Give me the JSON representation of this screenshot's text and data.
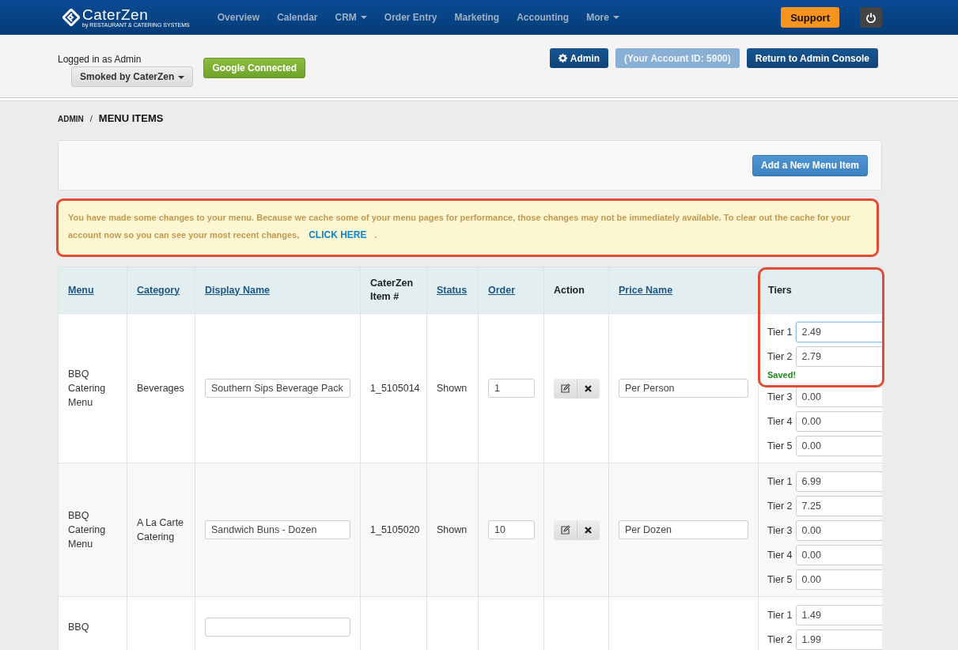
{
  "navbar": {
    "logo": {
      "name": "CaterZen",
      "tagline": "by RESTAURANT & CATERING SYSTEMS"
    },
    "items": [
      {
        "label": "Overview",
        "dropdown": false
      },
      {
        "label": "Calendar",
        "dropdown": false
      },
      {
        "label": "CRM",
        "dropdown": true
      },
      {
        "label": "Order Entry",
        "dropdown": false
      },
      {
        "label": "Marketing",
        "dropdown": false
      },
      {
        "label": "Accounting",
        "dropdown": false
      },
      {
        "label": "More",
        "dropdown": true
      }
    ],
    "support": "Support"
  },
  "account_bar": {
    "logged_in": "Logged in as Admin",
    "location": "Smoked by CaterZen",
    "google": "Google Connected",
    "admin": "Admin",
    "account_id": "(Your Account ID: 5900)",
    "return": "Return to Admin Console"
  },
  "breadcrumb": {
    "parent": "ADMIN",
    "separator": "/",
    "current": "MENU ITEMS"
  },
  "toolbar": {
    "add_button": "Add a New Menu Item"
  },
  "alert": {
    "highlighted": true,
    "text": "You have made some changes to your menu. Because we cache some of your menu pages for performance, those changes may not be immediately available. To clear out the cache for your account now so you can see your most recent changes,",
    "link": "CLICK HERE",
    "end": "."
  },
  "table": {
    "tiers_highlighted": true,
    "columns": [
      {
        "label": "Menu",
        "sortable": true
      },
      {
        "label": "Category",
        "sortable": true
      },
      {
        "label": "Display Name",
        "sortable": true
      },
      {
        "label": "CaterZen Item #",
        "sortable": false
      },
      {
        "label": "Status",
        "sortable": true
      },
      {
        "label": "Order",
        "sortable": true
      },
      {
        "label": "Action",
        "sortable": false
      },
      {
        "label": "Price Name",
        "sortable": true
      },
      {
        "label": "Tiers",
        "sortable": false
      }
    ],
    "rows": [
      {
        "menu": "BBQ Catering Menu",
        "category": "Beverages",
        "display_name": "Southern Sips Beverage Pack",
        "item_no": "1_5105014",
        "status": "Shown",
        "order": "1",
        "actions": true,
        "price_name": "Per Person",
        "tiers": [
          {
            "label": "Tier 1",
            "value": "2.49",
            "focused": true
          },
          {
            "label": "Tier 2",
            "value": "2.79",
            "focused": false
          }
        ],
        "saved": "Saved!",
        "tiers_after": [
          {
            "label": "Tier 3",
            "value": "0.00",
            "focused": false
          },
          {
            "label": "Tier 4",
            "value": "0.00",
            "focused": false
          },
          {
            "label": "Tier 5",
            "value": "0.00",
            "focused": false
          }
        ]
      },
      {
        "menu": "BBQ Catering Menu",
        "category": "A La Carte Catering",
        "display_name": "Sandwich Buns - Dozen",
        "item_no": "1_5105020",
        "status": "Shown",
        "order": "10",
        "actions": true,
        "price_name": "Per Dozen",
        "tiers": [
          {
            "label": "Tier 1",
            "value": "6.99",
            "focused": false
          },
          {
            "label": "Tier 2",
            "value": "7.25",
            "focused": false
          },
          {
            "label": "Tier 3",
            "value": "0.00",
            "focused": false
          },
          {
            "label": "Tier 4",
            "value": "0.00",
            "focused": false
          },
          {
            "label": "Tier 5",
            "value": "0.00",
            "focused": false
          }
        ]
      },
      {
        "menu": "BBQ",
        "tiers": [
          {
            "label": "Tier 1",
            "value": "1.49",
            "focused": false
          },
          {
            "label": "Tier 2",
            "value": "1.99",
            "focused": false
          }
        ]
      }
    ]
  }
}
